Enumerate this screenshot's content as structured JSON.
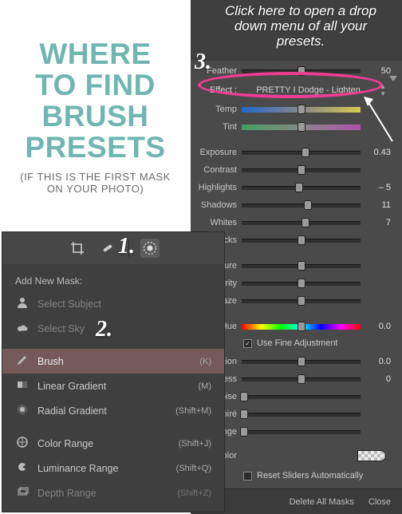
{
  "instruction_title_lines": {
    "l1": "WHERE",
    "l2": "TO FIND",
    "l3": "BRUSH",
    "l4": "PRESETS"
  },
  "instruction_sub": "(IF THIS IS THE FIRST MASK ON YOUR PHOTO)",
  "top_note": "Click here to open a drop down menu of all your presets.",
  "steps": {
    "s1": "1.",
    "s2": "2.",
    "s3": "3."
  },
  "right_panel": {
    "top_slider": {
      "label": "Feather",
      "value": "50",
      "pos": 50
    },
    "effect": {
      "label": "Effect :",
      "value": "PRETTY I Dodge - Lighten"
    },
    "temp": {
      "label": "Temp",
      "value": "",
      "pos": 50
    },
    "tint": {
      "label": "Tint",
      "value": "",
      "pos": 50
    },
    "sliders_a": [
      {
        "label": "Exposure",
        "value": "0.43",
        "pos": 54
      },
      {
        "label": "Contrast",
        "value": "",
        "pos": 50
      },
      {
        "label": "Highlights",
        "value": "– 5",
        "pos": 48
      },
      {
        "label": "Shadows",
        "value": "11",
        "pos": 56
      },
      {
        "label": "Whites",
        "value": "7",
        "pos": 54
      },
      {
        "label": "Blacks",
        "value": "",
        "pos": 50
      }
    ],
    "sliders_b": [
      {
        "label": "Texture",
        "value": "",
        "pos": 50
      },
      {
        "label": "Clarity",
        "value": "",
        "pos": 50
      },
      {
        "label": "Dehaze",
        "value": "",
        "pos": 50
      }
    ],
    "hue": {
      "label": "Hue",
      "value": "0.0",
      "pos": 50
    },
    "fine_adjust": {
      "label": "Use Fine Adjustment",
      "checked": true
    },
    "sliders_c": [
      {
        "label": "Saturation",
        "value": "0.0",
        "pos": 50
      },
      {
        "label": "Sharpness",
        "value": "0",
        "pos": 50
      },
      {
        "label": "Noise",
        "value": "",
        "pos": 2
      },
      {
        "label": "Moiré",
        "value": "",
        "pos": 2
      },
      {
        "label": "Defringe",
        "value": "",
        "pos": 2
      }
    ],
    "color_row": {
      "label": "Color"
    },
    "reset": {
      "label": "Reset Sliders Automatically",
      "checked": false
    },
    "footer": {
      "delete": "Delete All Masks",
      "close": "Close"
    }
  },
  "mask_panel": {
    "caption": "Add New Mask:",
    "items": [
      {
        "label": "Select Subject",
        "shortcut": "",
        "icon": "person-icon",
        "disabled": true
      },
      {
        "label": "Select Sky",
        "shortcut": "",
        "icon": "sky-icon",
        "disabled": true
      },
      {
        "label": "Brush",
        "shortcut": "(K)",
        "icon": "brush-icon",
        "disabled": false,
        "selected": true
      },
      {
        "label": "Linear Gradient",
        "shortcut": "(M)",
        "icon": "linear-gradient-icon",
        "disabled": false
      },
      {
        "label": "Radial Gradient",
        "shortcut": "(Shift+M)",
        "icon": "radial-gradient-icon",
        "disabled": false
      },
      {
        "label": "Color Range",
        "shortcut": "(Shift+J)",
        "icon": "color-range-icon",
        "disabled": false
      },
      {
        "label": "Luminance Range",
        "shortcut": "(Shift+Q)",
        "icon": "luminance-range-icon",
        "disabled": false
      },
      {
        "label": "Depth Range",
        "shortcut": "(Shift+Z)",
        "icon": "depth-range-icon",
        "disabled": true
      }
    ]
  }
}
